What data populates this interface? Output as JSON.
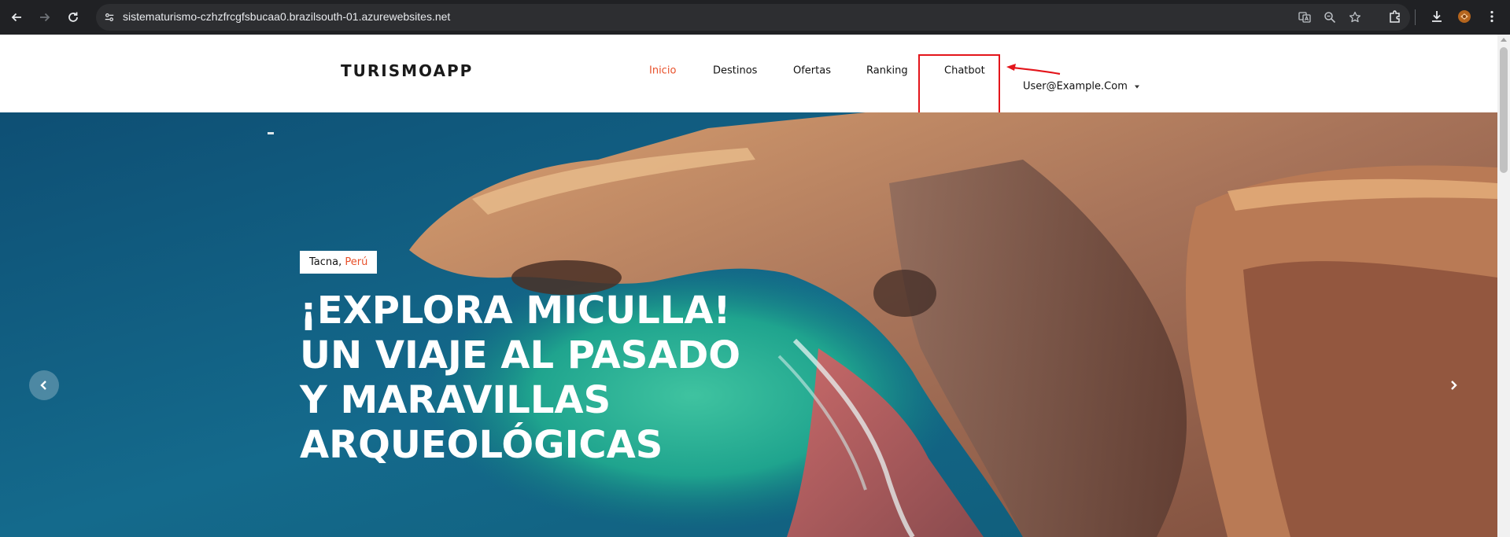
{
  "browser": {
    "url": "sistematurismo-czhzfrcgfsbucaa0.brazilsouth-01.azurewebsites.net",
    "back_icon": "arrow-left-icon",
    "forward_icon": "arrow-right-icon",
    "reload_icon": "reload-icon",
    "toolbar_icons": [
      "translate-icon",
      "zoom-icon",
      "bookmark-star-icon",
      "extensions-icon",
      "download-icon",
      "profile-icon",
      "menu-kebab-icon"
    ]
  },
  "header": {
    "brand": "TURISMOAPP",
    "nav": {
      "inicio": "Inicio",
      "destinos": "Destinos",
      "ofertas": "Ofertas",
      "ranking": "Ranking",
      "chatbot": "Chatbot"
    },
    "user": "User@Example.Com",
    "active_color": "#e8502a"
  },
  "hero": {
    "tag_city": "Tacna,",
    "tag_country": "Perú",
    "headline": [
      "¡EXPLORA MICULLA!",
      "UN VIAJE AL PASADO",
      "Y MARAVILLAS",
      "ARQUEOLÓGICAS"
    ],
    "prev_icon": "chevron-left-icon",
    "next_icon": "chevron-right-icon"
  },
  "annotation": {
    "highlight_color": "#e3151b"
  }
}
